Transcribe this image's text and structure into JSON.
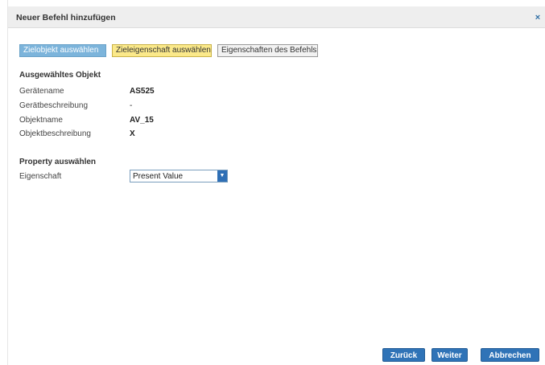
{
  "dialog": {
    "title": "Neuer Befehl hinzufügen",
    "close_icon": "×"
  },
  "steps": [
    {
      "label": "Zielobjekt auswählen",
      "state": "done"
    },
    {
      "label": "Zieleigenschaft auswählen",
      "state": "active"
    },
    {
      "label": "Eigenschaften des Befehls",
      "state": "pending"
    }
  ],
  "selected_object": {
    "heading": "Ausgewähltes Objekt",
    "fields": [
      {
        "label": "Gerätename",
        "value": "AS525"
      },
      {
        "label": "Gerätbeschreibung",
        "value": "-"
      },
      {
        "label": "Objektname",
        "value": "AV_15"
      },
      {
        "label": "Objektbeschreibung",
        "value": "X"
      }
    ]
  },
  "property": {
    "heading": "Property auswählen",
    "label": "Eigenschaft",
    "selected": "Present Value"
  },
  "buttons": {
    "back": "Zurück",
    "next": "Weiter",
    "cancel": "Abbrechen"
  },
  "colors": {
    "accent": "#2f73b7",
    "step_done": "#7cb4db",
    "step_active": "#fbe98a"
  }
}
